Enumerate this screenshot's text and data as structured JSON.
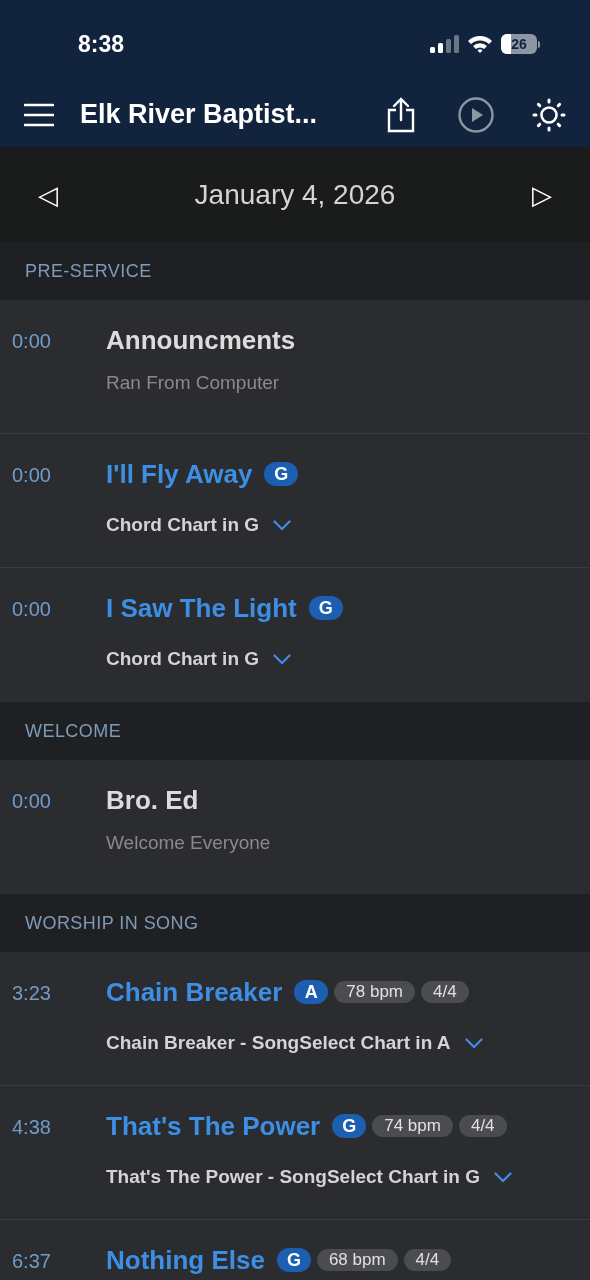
{
  "status_bar": {
    "time": "8:38",
    "battery": "26"
  },
  "nav": {
    "title": "Elk River Baptist..."
  },
  "date_bar": {
    "date": "January 4, 2026",
    "prev": "◁",
    "next": "▷"
  },
  "sections": [
    {
      "title": "PRE-SERVICE",
      "items": [
        {
          "kind": "plain",
          "time": "0:00",
          "title": "Announcments",
          "subtitle": "Ran From Computer"
        },
        {
          "kind": "song",
          "time": "0:00",
          "title": "I'll Fly Away",
          "key": "G",
          "subtitle": "Chord Chart in G"
        },
        {
          "kind": "song",
          "time": "0:00",
          "title": "I Saw The Light",
          "key": "G",
          "subtitle": "Chord Chart in G"
        }
      ]
    },
    {
      "title": "WELCOME",
      "items": [
        {
          "kind": "plain",
          "time": "0:00",
          "title": "Bro. Ed",
          "subtitle": "Welcome Everyone"
        }
      ]
    },
    {
      "title": "WORSHIP IN SONG",
      "items": [
        {
          "kind": "song",
          "time": "3:23",
          "title": "Chain Breaker",
          "key": "A",
          "bpm": "78 bpm",
          "meter": "4/4",
          "subtitle": "Chain Breaker - SongSelect Chart in A"
        },
        {
          "kind": "song",
          "time": "4:38",
          "title": "That's The Power",
          "key": "G",
          "bpm": "74 bpm",
          "meter": "4/4",
          "subtitle": "That's The Power - SongSelect Chart in G"
        },
        {
          "kind": "song",
          "time": "6:37",
          "title": "Nothing Else",
          "key": "G",
          "bpm": "68 bpm",
          "meter": "4/4"
        }
      ]
    }
  ]
}
